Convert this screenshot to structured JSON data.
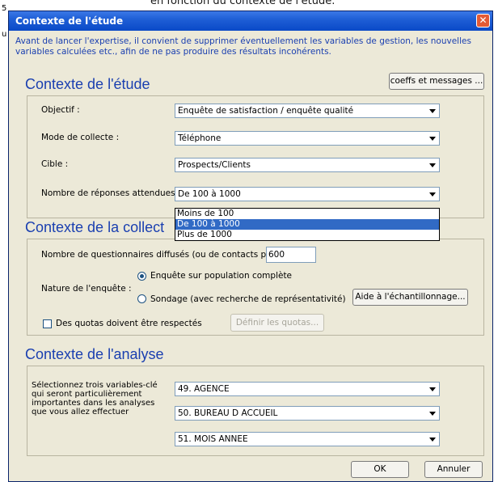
{
  "background": {
    "partial_text": "en fonction du contexte de l'étude.",
    "fragments": [
      "5",
      "u"
    ]
  },
  "dialog": {
    "title": "Contexte de l'étude",
    "intro": "Avant de lancer l'expertise, il convient de supprimer éventuellement les variables de gestion, les nouvelles variables calculées etc., afin de ne pas produire des résultats incohérents.",
    "coeffs_button": "coeffs et messages ...",
    "ok_button": "OK",
    "cancel_button": "Annuler"
  },
  "study": {
    "title": "Contexte de l'étude",
    "objectif_label": "Objectif :",
    "objectif_value": "Enquête de satisfaction / enquête qualité",
    "mode_label": "Mode de collecte :",
    "mode_value": "Téléphone",
    "cible_label": "Cible :",
    "cible_value": "Prospects/Clients",
    "reponses_label": "Nombre de réponses attendues :",
    "reponses_value": "De 100 à 1000",
    "reponses_options": [
      "Moins de 100",
      "De 100 à 1000",
      "Plus de 1000"
    ]
  },
  "collect": {
    "title": "Contexte de la collect",
    "questionnaires_label": "Nombre de questionnaires diffusés (ou de contacts pris) :",
    "questionnaires_value": "600",
    "nature_label": "Nature de l'enquête :",
    "radio_complete": "Enquête sur population complète",
    "radio_sondage": "Sondage (avec recherche de représentativité)",
    "aide_button": "Aide à l'échantillonnage...",
    "quotas_label": "Des quotas doivent être respectés",
    "definir_button": "Définir les quotas..."
  },
  "analysis": {
    "title": "Contexte de l'analyse",
    "description": "Sélectionnez trois variables-clé qui seront particulièrement importantes dans les analyses que vous allez effectuer",
    "variables": [
      "49. AGENCE",
      "50. BUREAU D ACCUEIL",
      "51. MOIS ANNEE"
    ]
  }
}
